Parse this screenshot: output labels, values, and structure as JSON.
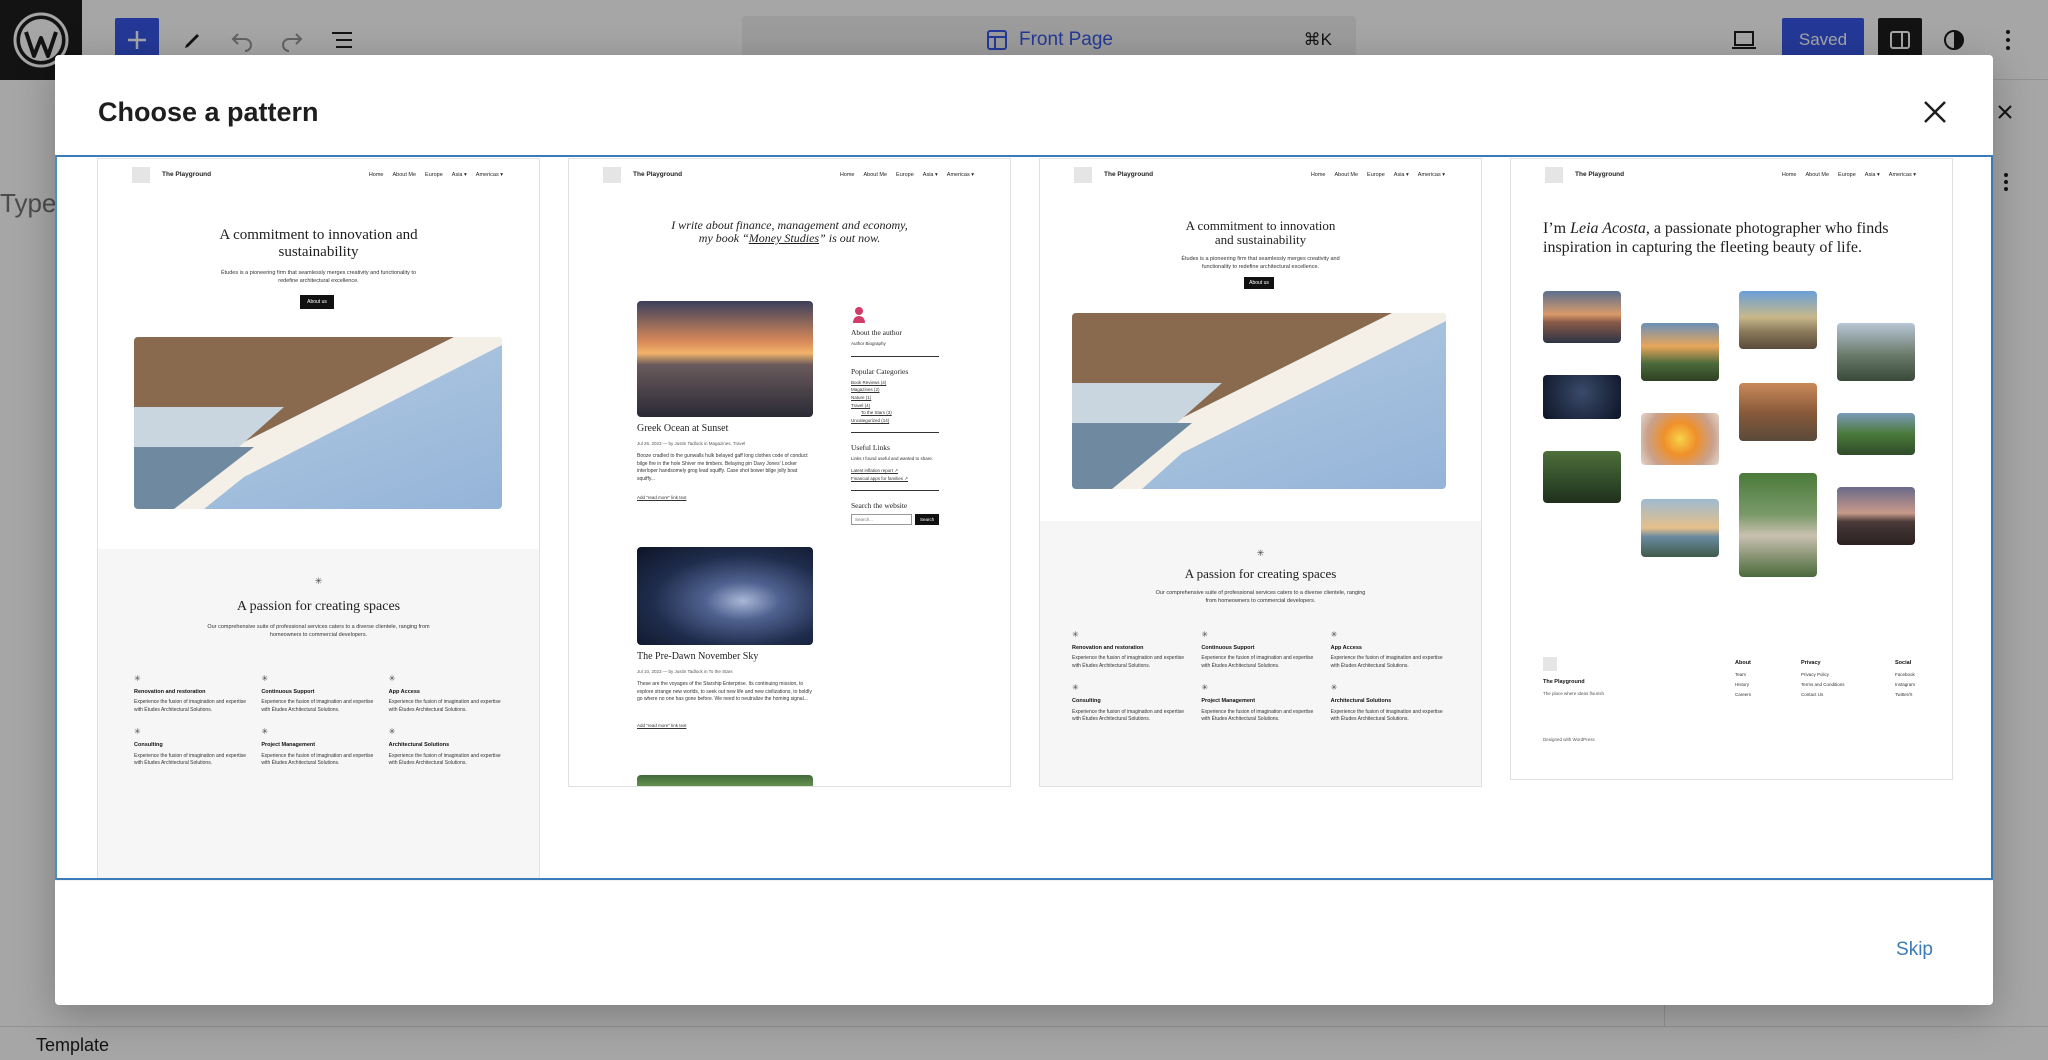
{
  "editor": {
    "document_title": "Front Page",
    "shortcut": "⌘K",
    "saved_label": "Saved",
    "canvas_hint": "Type",
    "breadcrumb": "Template"
  },
  "modal": {
    "title": "Choose a pattern",
    "skip_label": "Skip"
  },
  "patterns": [
    {
      "site": "The Playground",
      "nav": [
        "Home",
        "About Me",
        "Europe",
        "Asia ▾",
        "Americas ▾"
      ],
      "heading": "A commitment to innovation and sustainability",
      "intro": "Études is a pioneering firm that seamlessly merges creativity and functionality to redefine architectural excellence.",
      "button": "About us",
      "section_heading": "A passion for creating spaces",
      "section_intro": "Our comprehensive suite of professional services caters to a diverse clientele, ranging from homeowners to commercial developers.",
      "services": [
        {
          "title": "Renovation and restoration",
          "text": "Experience the fusion of imagination and expertise with Études Architectural Solutions."
        },
        {
          "title": "Continuous Support",
          "text": "Experience the fusion of imagination and expertise with Études Architectural Solutions."
        },
        {
          "title": "App Access",
          "text": "Experience the fusion of imagination and expertise with Études Architectural Solutions."
        },
        {
          "title": "Consulting",
          "text": "Experience the fusion of imagination and expertise with Études Architectural Solutions."
        },
        {
          "title": "Project Management",
          "text": "Experience the fusion of imagination and expertise with Études Architectural Solutions."
        },
        {
          "title": "Architectural Solutions",
          "text": "Experience the fusion of imagination and expertise with Études Architectural Solutions."
        }
      ]
    },
    {
      "site": "The Playground",
      "nav": [
        "Home",
        "About Me",
        "Europe",
        "Asia ▾",
        "Americas ▾"
      ],
      "intro_line1": "I write about finance, management and economy,",
      "intro_line2_pre": "my book “",
      "intro_book": "Money Studies",
      "intro_line2_post": "” is out now.",
      "posts": [
        {
          "title": "Greek Ocean at Sunset",
          "meta": "Jul 26, 2023 — by Justin Tadlock in Magazines, Travel",
          "excerpt": "Booze cradled to the gunwalls hulk belayed gaff long clothes code of conduct bilge fire in the hole Shiver me timbers. Belaying pin Davy Jones' Locker interloper handsomely grog lead squiffy. Case shot bower bilge jolly boat squiffy...",
          "link": "Add \"read more\" link text"
        },
        {
          "title": "The Pre-Dawn November Sky",
          "meta": "Jul 10, 2023 — by Justin Tadlock in To the Stars",
          "excerpt": "These are the voyages of the Starship Enterprise. Its continuing mission, to explore strange new worlds, to seek out new life and new civilizations, to boldly go where no one has gone before. We need to neutralize the homing signal...",
          "link": "Add \"read more\" link text"
        }
      ],
      "sidebar": {
        "about_heading": "About the author",
        "about_text": "Author Biography",
        "categories_heading": "Popular Categories",
        "categories": [
          "Book Reviews (4)",
          "Magazines (2)",
          "Nature (1)",
          "Travel (4)",
          "To the Stars (3)",
          "Uncategorized (14)"
        ],
        "links_heading": "Useful Links",
        "links_text": "Links I found useful and wanted to share.",
        "links": [
          "Latest inflation report ↗",
          "Financial apps for families ↗"
        ],
        "search_heading": "Search the website",
        "search_placeholder": "Search...",
        "search_button": "Search"
      }
    },
    {
      "site": "The Playground",
      "nav": [
        "Home",
        "About Me",
        "Europe",
        "Asia ▾",
        "Americas ▾"
      ],
      "heading_line1": "A commitment to innovation",
      "heading_line2": "and sustainability",
      "intro": "Études is a pioneering firm that seamlessly merges creativity and functionality to redefine architectural excellence.",
      "button": "About us",
      "section_heading": "A passion for creating spaces",
      "section_intro": "Our comprehensive suite of professional services caters to a diverse clientele, ranging from homeowners to commercial developers.",
      "services": [
        {
          "title": "Renovation and restoration",
          "text": "Experience the fusion of imagination and expertise with Études Architectural Solutions."
        },
        {
          "title": "Continuous Support",
          "text": "Experience the fusion of imagination and expertise with Études Architectural Solutions."
        },
        {
          "title": "App Access",
          "text": "Experience the fusion of imagination and expertise with Études Architectural Solutions."
        },
        {
          "title": "Consulting",
          "text": "Experience the fusion of imagination and expertise with Études Architectural Solutions."
        },
        {
          "title": "Project Management",
          "text": "Experience the fusion of imagination and expertise with Études Architectural Solutions."
        },
        {
          "title": "Architectural Solutions",
          "text": "Experience the fusion of imagination and expertise with Études Architectural Solutions."
        }
      ]
    },
    {
      "site": "The Playground",
      "nav": [
        "Home",
        "About Me",
        "Europe",
        "Asia ▾",
        "Americas ▾"
      ],
      "intro_pre": "I’m ",
      "intro_name": "Leia Acosta",
      "intro_post": ", a passionate photographer who finds inspiration in capturing the fleeting beauty of life.",
      "footer": {
        "site": "The Playground",
        "tagline": "The place where ideas flourish",
        "credit": "Designed with WordPress",
        "columns": [
          {
            "heading": "About",
            "items": [
              "Team",
              "History",
              "Careers"
            ]
          },
          {
            "heading": "Privacy",
            "items": [
              "Privacy Policy",
              "Terms and Conditions",
              "Contact Us"
            ]
          },
          {
            "heading": "Social",
            "items": [
              "Facebook",
              "Instagram",
              "Twitter/X"
            ]
          }
        ]
      }
    }
  ],
  "colors": {
    "accent": "#3858e9",
    "modal_focus_border": "#3a7bb8",
    "skip_link": "#3a7bb8"
  }
}
